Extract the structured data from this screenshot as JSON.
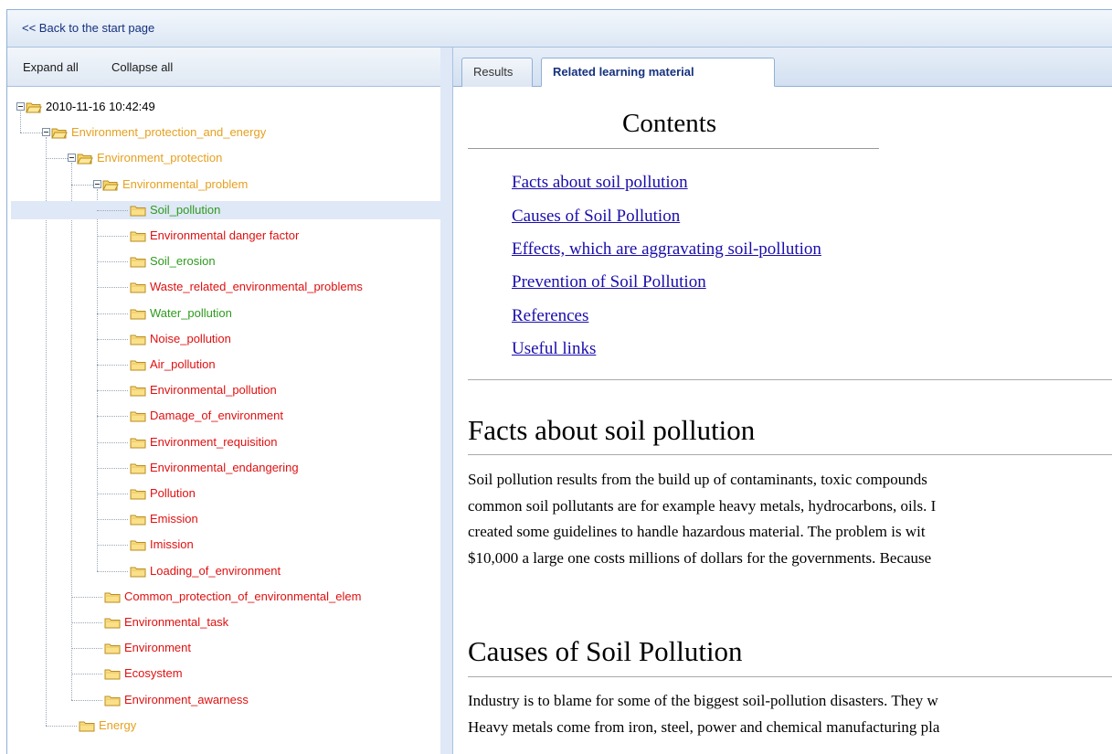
{
  "header": {
    "back_link": "<< Back to the start page"
  },
  "left_toolbar": {
    "expand_all": "Expand all",
    "collapse_all": "Collapse all"
  },
  "colors": {
    "green": "#2e9a1e",
    "orange": "#e6a020",
    "red": "#e01010",
    "black": "#000000",
    "selected_bg": "#dfe8f6"
  },
  "tree": [
    {
      "label": "2010-11-16 10:42:49",
      "level": 0,
      "toggle": true,
      "open": true,
      "color": "black"
    },
    {
      "label": "Environment_protection_and_energy",
      "level": 1,
      "toggle": true,
      "open": true,
      "color": "orange"
    },
    {
      "label": "Environment_protection",
      "level": 2,
      "toggle": true,
      "open": true,
      "color": "orange"
    },
    {
      "label": "Environmental_problem",
      "level": 3,
      "toggle": true,
      "open": true,
      "color": "orange"
    },
    {
      "label": "Soil_pollution",
      "level": 4,
      "color": "green",
      "selected": true
    },
    {
      "label": "Environmental danger factor",
      "level": 4,
      "color": "red"
    },
    {
      "label": "Soil_erosion",
      "level": 4,
      "color": "green"
    },
    {
      "label": "Waste_related_environmental_problems",
      "level": 4,
      "color": "red"
    },
    {
      "label": "Water_pollution",
      "level": 4,
      "color": "green"
    },
    {
      "label": "Noise_pollution",
      "level": 4,
      "color": "red"
    },
    {
      "label": "Air_pollution",
      "level": 4,
      "color": "red"
    },
    {
      "label": "Environmental_pollution",
      "level": 4,
      "color": "red"
    },
    {
      "label": "Damage_of_environment",
      "level": 4,
      "color": "red"
    },
    {
      "label": "Environment_requisition",
      "level": 4,
      "color": "red"
    },
    {
      "label": "Environmental_endangering",
      "level": 4,
      "color": "red"
    },
    {
      "label": "Pollution",
      "level": 4,
      "color": "red"
    },
    {
      "label": "Emission",
      "level": 4,
      "color": "red"
    },
    {
      "label": "Imission",
      "level": 4,
      "color": "red"
    },
    {
      "label": "Loading_of_environment",
      "level": 4,
      "color": "red"
    },
    {
      "label": "Common_protection_of_environmental_elem",
      "level": 3,
      "color": "red"
    },
    {
      "label": "Environmental_task",
      "level": 3,
      "color": "red"
    },
    {
      "label": "Environment",
      "level": 3,
      "color": "red"
    },
    {
      "label": "Ecosystem",
      "level": 3,
      "color": "red"
    },
    {
      "label": "Environment_awarness",
      "level": 3,
      "color": "red"
    },
    {
      "label": "Energy",
      "level": 2,
      "color": "orange"
    }
  ],
  "tabs": [
    {
      "label": "Results",
      "active": false
    },
    {
      "label": "Related learning material",
      "active": true
    }
  ],
  "article": {
    "toc_title": "Contents",
    "toc": [
      "Facts about soil pollution",
      "Causes of Soil Pollution",
      "Effects, which are aggravating soil-pollution",
      "Prevention of Soil Pollution",
      "References",
      "Useful links"
    ],
    "sections": [
      {
        "heading": "Facts about soil pollution",
        "lines": [
          "Soil pollution results from the build up of contaminants, toxic compounds",
          "common soil pollutants are for example heavy metals, hydrocarbons, oils. I",
          "created some guidelines to handle hazardous material. The problem is wit",
          "$10,000 a large one costs millions of dollars for the governments. Because"
        ]
      },
      {
        "heading": "Causes of Soil Pollution",
        "lines": [
          "Industry is to blame for some of the biggest soil-pollution disasters. They w",
          "Heavy metals come from iron, steel, power and chemical manufacturing pla"
        ]
      }
    ]
  }
}
